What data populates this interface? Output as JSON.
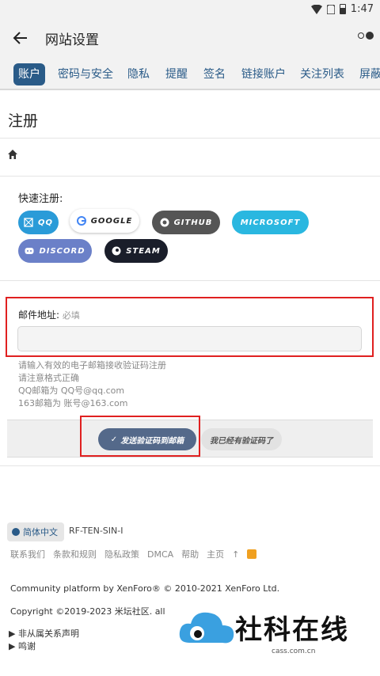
{
  "status": {
    "time": "1:47"
  },
  "appbar": {
    "title": "网站设置"
  },
  "tabs": [
    "账户",
    "密码与安全",
    "隐私",
    "提醒",
    "签名",
    "链接账户",
    "关注列表",
    "屏蔽"
  ],
  "page": {
    "heading": "注册"
  },
  "quick": {
    "label": "快速注册:",
    "buttons": {
      "qq": "QQ",
      "google": "GOOGLE",
      "github": "GITHUB",
      "microsoft": "MICROSOFT",
      "discord": "DISCORD",
      "steam": "STEAM"
    }
  },
  "email": {
    "label": "邮件地址:",
    "required": "必填",
    "hints": [
      "请输入有效的电子邮箱接收验证码注册",
      "请注意格式正确",
      "QQ邮箱为 QQ号@qq.com",
      "163邮箱为 账号@163.com"
    ]
  },
  "actions": {
    "send": "发送验证码到邮箱",
    "have": "我已经有验证码了"
  },
  "footer": {
    "language": "简体中文",
    "style": "RF-TEN-SIN-I",
    "links": [
      "联系我们",
      "条款和规则",
      "隐私政策",
      "DMCA",
      "帮助",
      "主页",
      "↑"
    ],
    "copyright1": "Community platform by XenForo® © 2010-2021 XenForo Ltd.",
    "copyright2": "Copyright ©2019-2023 米坛社区. all r",
    "disclaimer1": "▶ 非从属关系声明",
    "disclaimer2": "▶ 鸣谢"
  },
  "watermark": {
    "name": "社科在线",
    "url": "cass.com.cn"
  },
  "colors": {
    "accent": "#2a5b88",
    "highlight": "#e02020"
  }
}
